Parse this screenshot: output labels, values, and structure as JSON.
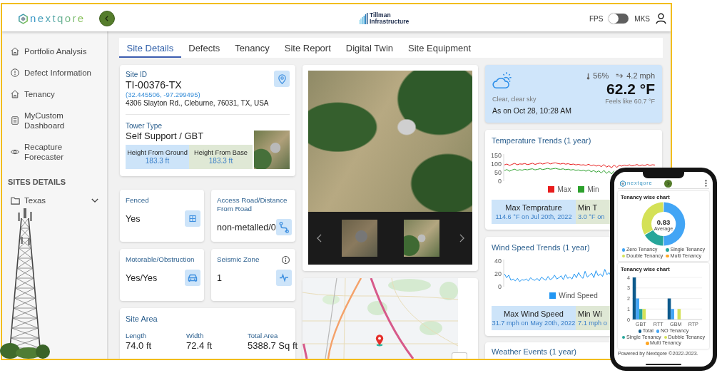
{
  "header": {
    "logo": "nextqore",
    "brand": [
      "Tillman",
      "Infrastructure"
    ],
    "units": {
      "left_label": "FPS",
      "right_label": "MKS",
      "on": false
    }
  },
  "sidebar": {
    "items": [
      {
        "label": "Portfolio Analysis",
        "selected": false
      },
      {
        "label": "Defect Information",
        "selected": false
      },
      {
        "label": "Tenancy",
        "selected": false
      },
      {
        "label": "MyCustom Dashboard",
        "selected": false
      },
      {
        "label": "Recapture Forecaster",
        "selected": false
      }
    ],
    "section_title": "SITES DETAILS",
    "folders": [
      {
        "label": "Texas",
        "expanded": false
      }
    ]
  },
  "tabs": [
    {
      "label": "Site Details",
      "selected": true
    },
    {
      "label": "Defects",
      "selected": false
    },
    {
      "label": "Tenancy",
      "selected": false
    },
    {
      "label": "Site Report",
      "selected": false
    },
    {
      "label": "Digital Twin",
      "selected": false
    },
    {
      "label": "Site Equipment",
      "selected": false
    }
  ],
  "site": {
    "id_label": "Site ID",
    "id": "TI-00376-TX",
    "coordinates": "(32.445506, -97.299495)",
    "address": "4306 Slayton Rd., Cleburne, 76031, TX, USA",
    "tower_type_label": "Tower Type",
    "tower_type": "Self Support / GBT",
    "heights": [
      {
        "label": "Height From Ground",
        "value": "183.3 ft"
      },
      {
        "label": "Height From Base",
        "value": "183.3 ft"
      }
    ]
  },
  "facts": [
    {
      "label": "Fenced",
      "value": "Yes",
      "info": false
    },
    {
      "label": "Access Road/Distance From Road",
      "value": "non-metalled/0",
      "info": false
    },
    {
      "label": "Motorable/Obstruction",
      "value": "Yes/Yes",
      "info": false
    },
    {
      "label": "Seismic Zone",
      "value": "1",
      "info": true
    }
  ],
  "site_area": {
    "title": "Site Area",
    "fields": [
      {
        "label": "Length",
        "value": "74.0 ft"
      },
      {
        "label": "Width",
        "value": "72.4 ft"
      },
      {
        "label": "Total Area",
        "value": "5388.7 Sq ft"
      }
    ]
  },
  "weather": {
    "condition": "Clear, clear sky",
    "as_on": "As on Oct 28, 10:28 AM",
    "humidity": "56%",
    "wind": "4.2 mph",
    "temperature": "62.2 °F",
    "feels_like": "Feels like 60.7 °F"
  },
  "temperature_trends": {
    "title": "Temperature Trends (1 year)",
    "chart_data": {
      "type": "line",
      "ylim": [
        0,
        150
      ],
      "yticks": [
        0,
        50,
        100,
        150
      ],
      "series": [
        {
          "name": "Max",
          "color": "#e81c1c",
          "values": [
            95,
            100,
            92,
            98,
            104,
            96,
            101,
            99,
            103,
            97,
            100,
            105,
            98,
            102,
            106,
            100,
            104,
            108,
            101,
            105,
            107,
            103,
            100,
            104,
            99,
            102,
            97,
            100,
            95,
            98,
            94,
            96,
            92,
            99,
            90,
            95,
            88,
            93,
            85,
            97,
            82,
            90,
            78,
            95,
            80,
            92,
            88,
            94,
            90,
            96,
            89,
            93,
            97,
            90,
            95,
            91,
            98,
            92,
            96,
            94
          ]
        },
        {
          "name": "Min",
          "color": "#2ca02c",
          "values": [
            62,
            68,
            58,
            65,
            70,
            63,
            67,
            64,
            69,
            66,
            70,
            72,
            66,
            69,
            73,
            68,
            71,
            74,
            70,
            72,
            75,
            71,
            69,
            72,
            67,
            70,
            65,
            68,
            63,
            66,
            60,
            64,
            58,
            66,
            55,
            62,
            52,
            60,
            48,
            63,
            45,
            58,
            42,
            60,
            null,
            null,
            null,
            null,
            null,
            null,
            null,
            null,
            null,
            null,
            null,
            null,
            null,
            null,
            null,
            null
          ]
        }
      ]
    },
    "stats": [
      {
        "label": "Max Temprature",
        "value": "114.6 °F on Jul 20th, 2022"
      },
      {
        "label": "Min T",
        "value": "3.0 °F on"
      }
    ]
  },
  "wind_speed_trends": {
    "title": "Wind Speed Trends (1 year)",
    "chart_data": {
      "type": "line",
      "ylim": [
        0,
        40
      ],
      "yticks": [
        0,
        20,
        40
      ],
      "series": [
        {
          "name": "Wind Speed",
          "color": "#2196f3",
          "values": [
            20,
            14,
            18,
            10,
            12,
            9,
            13,
            8,
            11,
            10,
            12,
            9,
            14,
            11,
            10,
            13,
            9,
            15,
            12,
            10,
            16,
            11,
            13,
            18,
            12,
            14,
            17,
            11,
            19,
            13,
            15,
            12,
            20,
            14,
            22,
            16,
            13,
            24,
            15,
            18,
            21,
            14,
            25,
            17,
            20,
            16,
            27,
            19,
            22,
            15,
            null,
            null,
            null,
            null,
            null,
            null,
            null,
            null,
            null,
            null,
            null,
            null,
            null,
            null,
            null,
            null,
            null,
            null,
            null,
            null
          ]
        }
      ]
    },
    "stats": [
      {
        "label": "Max Wind Speed",
        "value": "31.7 mph on May 20th, 2022"
      },
      {
        "label": "Min Wi",
        "value": "7.1 mph o"
      }
    ]
  },
  "weather_events": {
    "title": "Weather Events (1 year)"
  },
  "phone": {
    "logo": "nextqore",
    "donut_card": {
      "title": "Tenancy wise chart",
      "center_value": "0.83",
      "center_label": "Average",
      "legend": [
        {
          "label": "Zero Tenancy",
          "color": "#42a5f5"
        },
        {
          "label": "Single Tenancy",
          "color": "#26a69a"
        },
        {
          "label": "Double Tenancy",
          "color": "#d4e157"
        },
        {
          "label": "Multi Tenancy",
          "color": "#ffa726"
        }
      ]
    },
    "bar_card": {
      "title": "Tenancy wise chart",
      "chart_data": {
        "type": "bar",
        "categories": [
          "GBT",
          "RTT",
          "GBM",
          "RTP"
        ],
        "ylim": [
          0,
          4
        ],
        "yticks": [
          0,
          1,
          2,
          3,
          4
        ],
        "grid": true,
        "series": [
          {
            "name": "Total",
            "color": "#0d5a8c",
            "values": [
              4,
              0,
              2,
              0
            ]
          },
          {
            "name": "NO Tenancy",
            "color": "#42a5f5",
            "values": [
              2,
              0,
              1,
              0
            ]
          },
          {
            "name": "Single Tenancy",
            "color": "#26a69a",
            "values": [
              1,
              0,
              0,
              0
            ]
          },
          {
            "name": "Dubble Tenancy",
            "color": "#d4e157",
            "values": [
              1,
              0,
              1,
              0
            ]
          },
          {
            "name": "Multi Tenancy",
            "color": "#ffa726",
            "values": [
              0,
              0,
              0,
              0
            ]
          }
        ]
      }
    },
    "footer": "Powered by Nextqore ©2022-2023."
  }
}
